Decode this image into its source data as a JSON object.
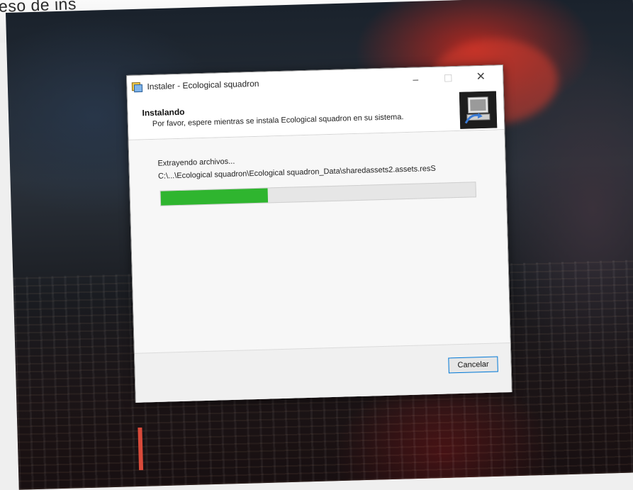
{
  "caption": {
    "text": "eso de ins"
  },
  "window": {
    "title": "Instaler - Ecological squadron",
    "controls": {
      "minimize": "–",
      "maximize": "☐",
      "close": "✕"
    }
  },
  "header": {
    "title": "Instalando",
    "subtitle": "Por favor, espere mientras se instala Ecological squadron en su sistema."
  },
  "body": {
    "status": "Extrayendo archivos...",
    "path": "C:\\...\\Ecological squadron\\Ecological squadron_Data\\sharedassets2.assets.resS",
    "progress_fraction": 0.34
  },
  "footer": {
    "cancel_label": "Cancelar"
  },
  "colors": {
    "progress_green": "#2fb52f",
    "focus_blue": "#0078d7"
  }
}
